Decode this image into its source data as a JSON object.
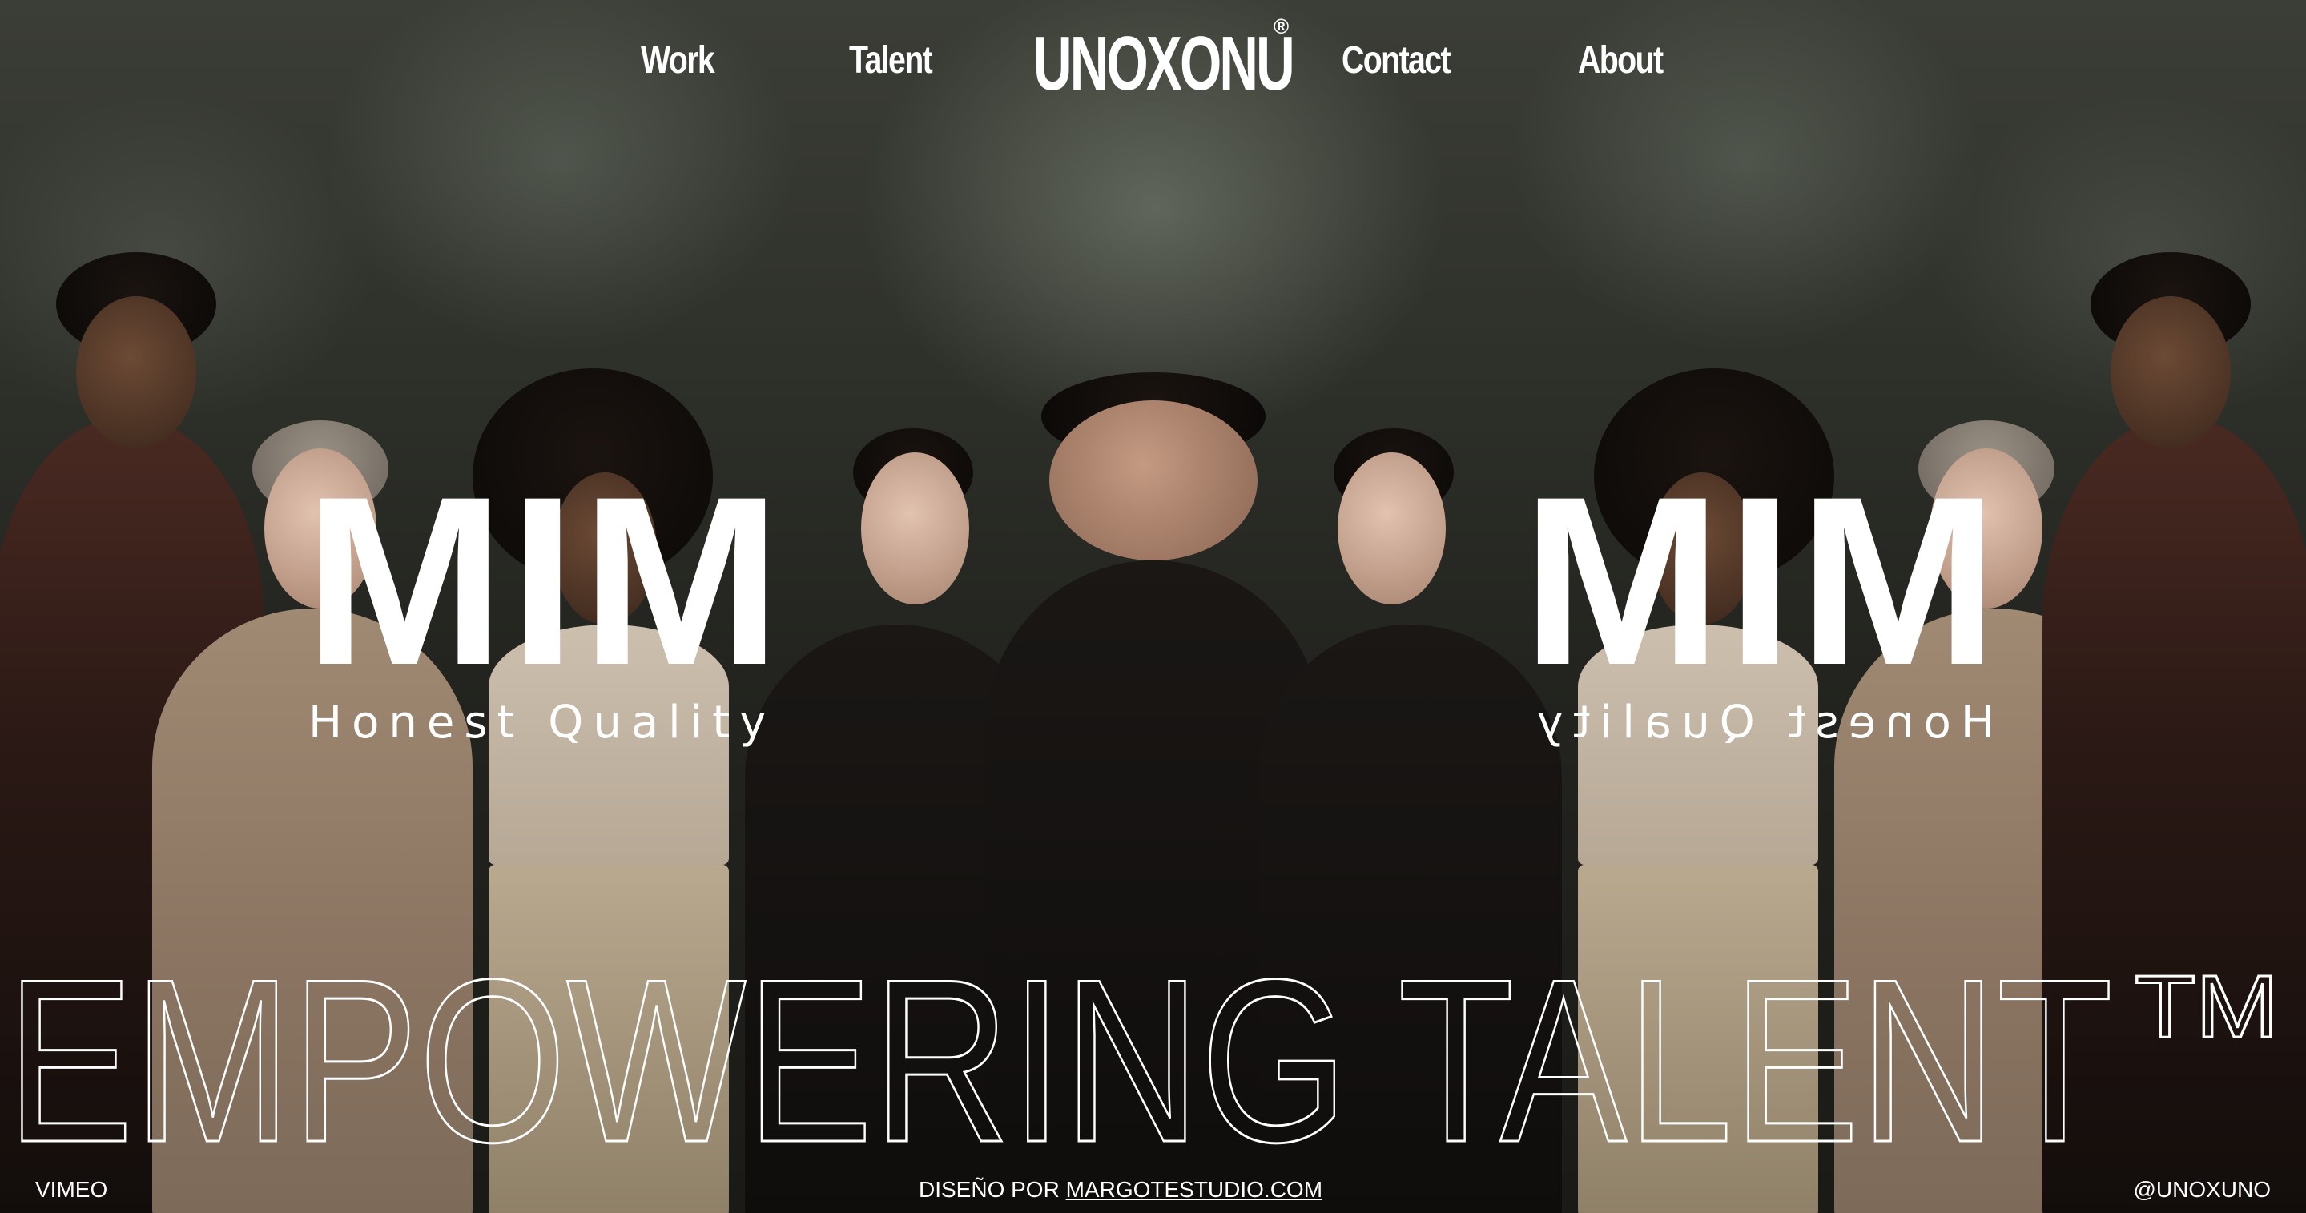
{
  "nav": {
    "work_label": "Work",
    "talent_label": "Talent",
    "logo_text": "UNOXONU",
    "logo_mark": "®",
    "contact_label": "Contact",
    "about_label": "About"
  },
  "hero": {
    "brand_left": "MIM",
    "tagline_left": "Honest Quality",
    "brand_right": "MIM",
    "tagline_right": "Honest Quality",
    "headline": "EMPOWERING TALENT",
    "headline_mark": "TM"
  },
  "footer": {
    "vimeo_label": "VIMEO",
    "credit_prefix": "DISEÑO POR ",
    "credit_link": "MARGOTESTUDIO.COM",
    "social_handle": "@UNOXUNO"
  },
  "colors": {
    "text": "#ffffff",
    "background": "#23241f"
  }
}
